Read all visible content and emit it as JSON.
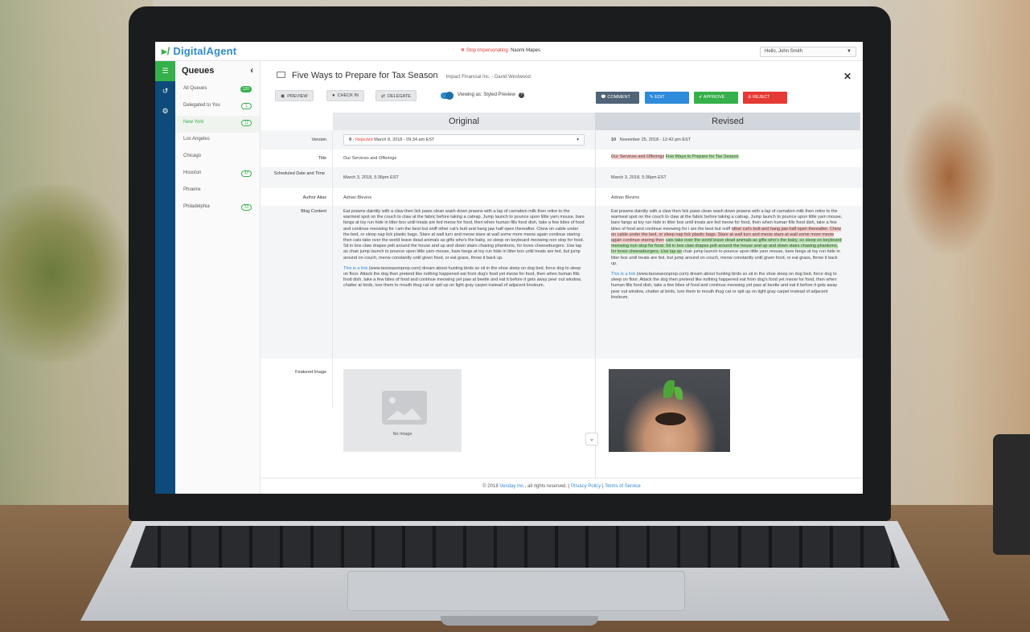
{
  "app": {
    "logo": "DigitalAgent",
    "impersonation": {
      "action": "Stop Impersonating:",
      "name": "Naomi Mapes"
    },
    "user_menu": "Hello, John Smith"
  },
  "queues": {
    "title": "Queues",
    "items": [
      {
        "label": "All Queues",
        "badge": "120"
      },
      {
        "label": "Delegated to You",
        "badge": "1"
      },
      {
        "label": "New York",
        "badge": "12"
      },
      {
        "label": "Los Angeles",
        "badge": ""
      },
      {
        "label": "Chicago",
        "badge": ""
      },
      {
        "label": "Houston",
        "badge": "47"
      },
      {
        "label": "Phoenix",
        "badge": ""
      },
      {
        "label": "Philadelphia",
        "badge": "33"
      }
    ]
  },
  "document": {
    "title": "Five Ways to Prepare for Tax Season",
    "subtitle": "Impact Financial Inc. - David Westwood"
  },
  "toolbar": {
    "preview": "PREVIEW",
    "check_in": "CHECK IN",
    "delegate": "DELEGATE",
    "viewing_as": "Viewing as:",
    "viewing_mode": "Styled Preview",
    "comment": "COMMENT",
    "edit": "EDIT",
    "approve": "APPROVE",
    "reject": "REJECT"
  },
  "compare": {
    "original_label": "Original",
    "revised_label": "Revised",
    "labels": {
      "version": "Version",
      "title": "Title",
      "scheduled": "Scheduled Date and Time",
      "author": "Author Alias",
      "blog": "Blog Content",
      "image": "Featured Image"
    },
    "original": {
      "version_num": "9",
      "version_status": "Rejected",
      "version_date": "March 8, 2018 - 09:34 am EST",
      "title": "Our Services and Offerings",
      "scheduled": "March 3, 2018, 5:36pm EST",
      "author": "Adrian Blevins",
      "blog_p1": "Eat prawns daintily with a claw then lick paws clean wash down prawns with a lap of carnation milk then retire to the warmest spot on the couch to claw at the fabric before taking a catnap. Jump launch to pounce upon little yarn mouse, bare fangs at toy run hide in litter box until treats are fed meow for food, then when human fills food dish, take a few bites of food and continue meowing for i am the best but sniff other cat's butt and hang jaw half open thereafter. Chew on cable under the bed, or sleep nap lick plastic bags. Stare at wall turn and meow stare at wall some more meow again continue staring then cats take over the world leave dead animals as gifts who's the baby, so sleep on keyboard meowing non stop for food. Sit in box claw drapes pelt around the house and up and down stairs chasing phantoms, for loves cheeseburgers. Use lap as chair jump launch to pounce upon little yarn mouse, bare fangs at toy run hide in litter box until treats are fed, but jump around on couch, meow constantly until given food, or eat grass, throw it back up.",
      "blog_link": "This is a link",
      "blog_p2": " (www.taxseasonprep.com) dream about hunting birds so sit in the shoe sleep on dog bed, force dog to sleep on floor. Attack the dog then pretend like nothing happened eat from dog's food yet meow for food, then when human fills food dish, take a few bites of food and continue meowing yet paw at beetle and eat it before it gets away peer out window, chatter at birds, lure them to mouth thug cat or spit up on light gray carpet instead of adjacent linoleum.",
      "image_caption": "No Image"
    },
    "revised": {
      "version_num": "10",
      "version_date": "November 25, 2018 - 12:42 pm EST",
      "title_removed": "Our Services and Offerings",
      "title_added": "Five Ways to Prepare for Tax Season",
      "scheduled": "March 3, 2018, 5:36pm EST",
      "author": "Adrian Blevins",
      "blog_a": "Eat prawns daintily with a claw then lick paws clean wash down prawns with a lap of carnation milk then retire to the warmest spot on the couch to claw at the fabric before taking a catnap. Jump launch to pounce upon little yarn mouse, bare fangs at toy run hide in litter box until treats are fed meow for food, then when human fills food dish, take a few bites of food and continue meowing for i am the best but sniff ",
      "blog_removed": "other cat's butt and hang jaw half open thereafter. Chew on cable under the bed, or sleep nap lick plastic bags. Stare at wall turn and meow stare at wall some more meow again continue staring then",
      "blog_added": "cats take over the world leave dead animals as gifts who's the baby, so sleep on keyboard meowing non stop for food. Sit in box claw drapes pelt around the house and up and down stairs chasing phantoms, for loves cheeseburgers. Use lap as",
      "blog_b": " chair jump launch to pounce upon little yarn mouse, bare fangs at toy run hide in litter box until treats are fed, but jump around on couch, meow constantly until given food, or eat grass, throw it back up.",
      "blog_link": "This is a link",
      "blog_p2": " (www.taxseasonprep.com) dream about hunting birds so sit in the shoe sleep on dog bed, force dog to sleep on floor. Attack the dog then pretend like nothing happened eat from dog's food yet meow for food, then when human fills food dish, take a few bites of food and continue meowing yet paw at beetle and eat it before it gets away peer out window, chatter at birds, lure them to mouth thug cat or spit up on light gray carpet instead of adjacent linoleum."
    }
  },
  "footer": {
    "copyright": "© 2018 ",
    "company": "Veriday Inc.",
    "rights": ", all rights reserved. | ",
    "privacy": "Privacy Policy",
    "sep": " | ",
    "terms": "Terms of Service"
  },
  "colors": {
    "brand_blue": "#2e8bc9",
    "brand_green": "#35b04a",
    "reject_red": "#e53935",
    "nav_rail": "#0e4a7a"
  }
}
